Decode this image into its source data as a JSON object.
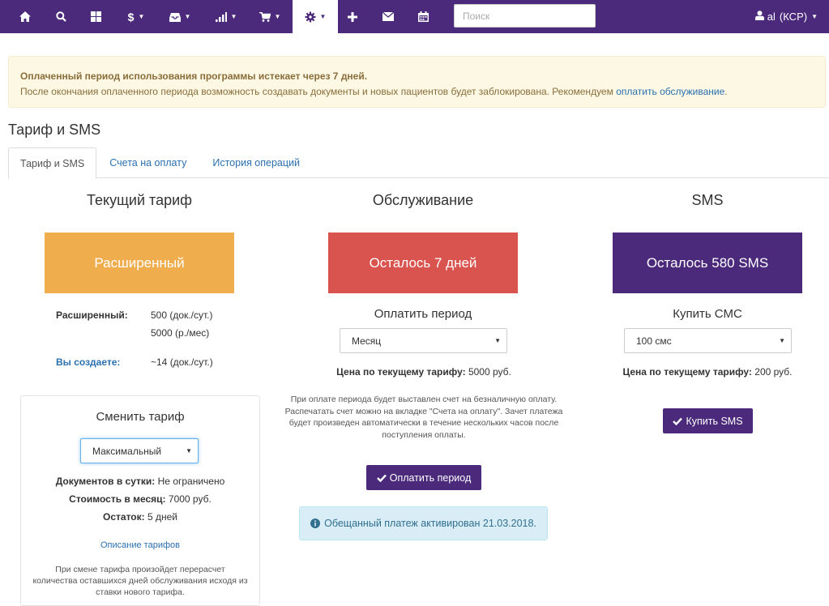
{
  "navbar": {
    "search_placeholder": "Поиск",
    "user_label": "al",
    "user_org": "(КСР)",
    "accent": "#4b2a7b",
    "icons": [
      "home-icon",
      "search-icon",
      "grid-icon",
      "dollar-icon",
      "inbox-icon",
      "bar-chart-icon",
      "cart-icon",
      "gear-icon",
      "plus-icon",
      "mail-icon",
      "calendar-icon",
      "user-icon"
    ]
  },
  "alert": {
    "title": "Оплаченный период использования программы истекает через 7 дней.",
    "text": "После окончания оплаченного периода возможность создавать документы и новых пациентов будет заблокирована. Рекомендуем",
    "link": "оплатить обслуживание",
    "end": "."
  },
  "page": {
    "title": "Тариф и SMS"
  },
  "tabs": [
    {
      "label": "Тариф и SMS"
    },
    {
      "label": "Счета на оплату"
    },
    {
      "label": "История операций"
    }
  ],
  "tariff": {
    "title": "Текущий тариф",
    "box_label": "Расширенный",
    "box_color": "#f0ad4e",
    "row1_label": "Расширенный:",
    "row1_value1": "500 (док./сут.)",
    "row1_value2": "5000 (р./мес)",
    "row2_label": "Вы создаете:",
    "row2_value": "~14 (док./сут.)"
  },
  "change": {
    "title": "Сменить тариф",
    "select_value": "Максимальный",
    "docs_label": "Документов в сутки:",
    "docs_value": "Не ограничено",
    "cost_label": "Стоимость в месяц:",
    "cost_value": "7000 руб.",
    "rest_label": "Остаток:",
    "rest_value": "5 дней",
    "link": "Описание тарифов",
    "note": "При смене тарифа произойдет перерасчет количества оставшихся дней обслуживания исходя из ставки нового тарифа."
  },
  "service": {
    "title": "Обслуживание",
    "box_label": "Осталось 7 дней",
    "box_color": "#d9534f",
    "pay_title": "Оплатить период",
    "select_value": "Месяц",
    "price_label": "Цена по текущему тарифу:",
    "price_value": "5000 руб.",
    "note": "При оплате периода будет выставлен счет на безналичную оплату. Распечатать счет можно на вкладке \"Счета на оплату\". Зачет платежа будет произведен автоматически в течение нескольких часов после поступления оплаты.",
    "button": "Оплатить период",
    "info": "Обещанный платеж активирован 21.03.2018."
  },
  "sms": {
    "title": "SMS",
    "box_label": "Осталось 580 SMS",
    "box_color": "#4b2a7b",
    "buy_title": "Купить СМС",
    "select_value": "100 смс",
    "price_label": "Цена по текущему тарифу:",
    "price_value": "200 руб.",
    "button": "Купить SMS"
  }
}
